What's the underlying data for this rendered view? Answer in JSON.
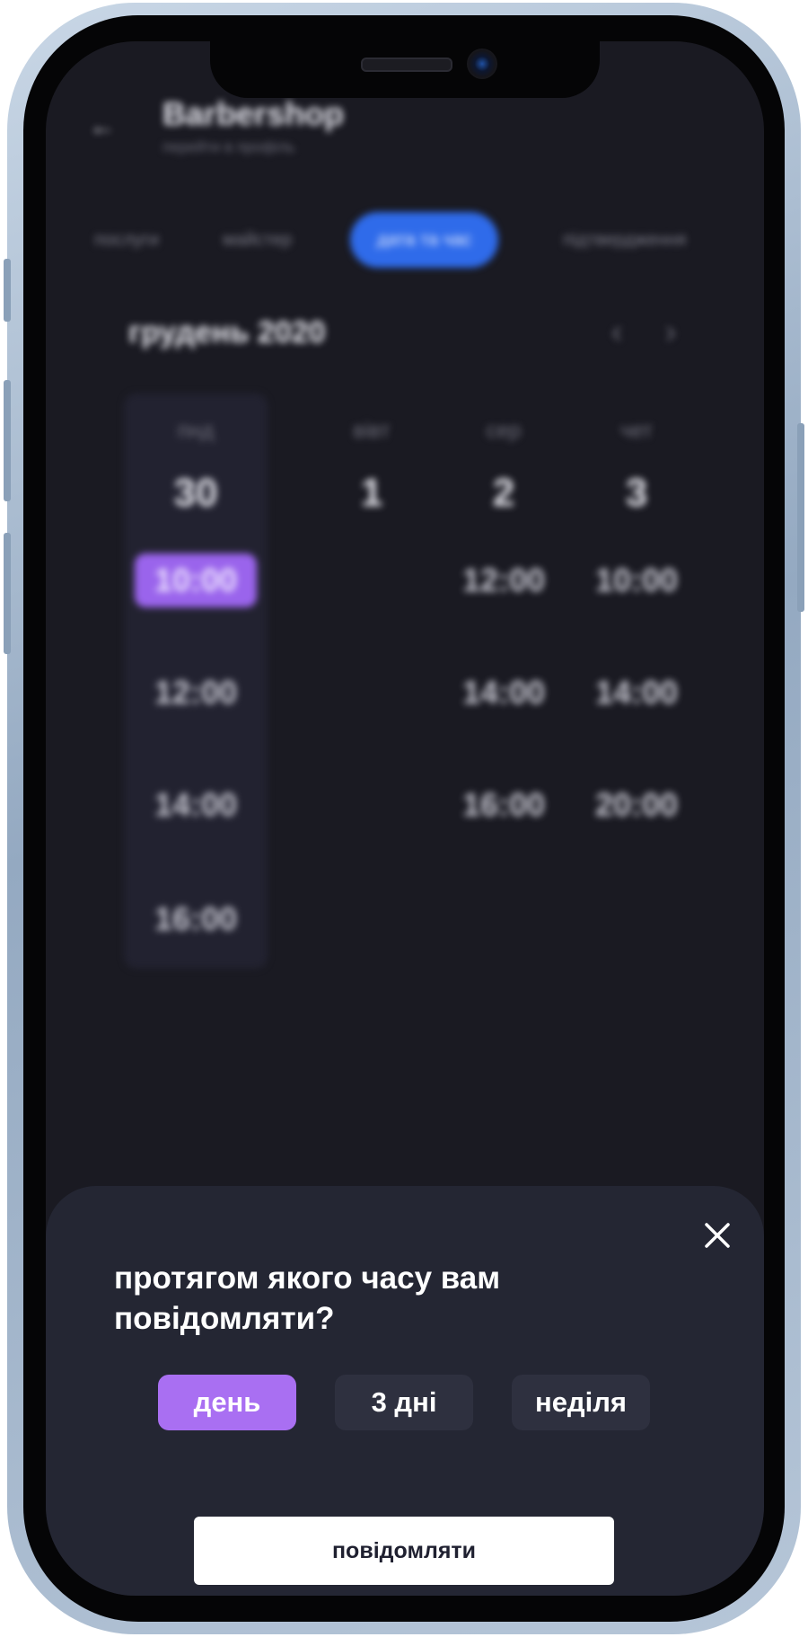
{
  "app": {
    "title": "Barbershop",
    "subtitle": "перейти в профіль"
  },
  "steps": [
    "послуги",
    "майстер",
    "дата та час",
    "підтвердження"
  ],
  "active_step": "дата та час",
  "calendar": {
    "month_label": "грудень 2020",
    "days": [
      {
        "name": "пнд",
        "number": "30",
        "slots": [
          "10:00",
          "12:00",
          "14:00",
          "16:00"
        ],
        "selected_slot": "10:00"
      },
      {
        "name": "вівт",
        "number": "1",
        "slots": []
      },
      {
        "name": "сер",
        "number": "2",
        "slots": [
          "12:00",
          "14:00",
          "16:00"
        ]
      },
      {
        "name": "чет",
        "number": "3",
        "slots": [
          "10:00",
          "14:00",
          "20:00"
        ]
      }
    ]
  },
  "sheet": {
    "question": "протягом якого часу вам повідомляти?",
    "options": [
      "день",
      "3 дні",
      "неділя"
    ],
    "selected_option": "день",
    "submit_label": "повідомляти"
  },
  "colors": {
    "accent_purple": "#a96ff2",
    "accent_blue": "#2f6bea",
    "sheet_bg": "#242633",
    "screen_bg": "#1a1a22"
  }
}
